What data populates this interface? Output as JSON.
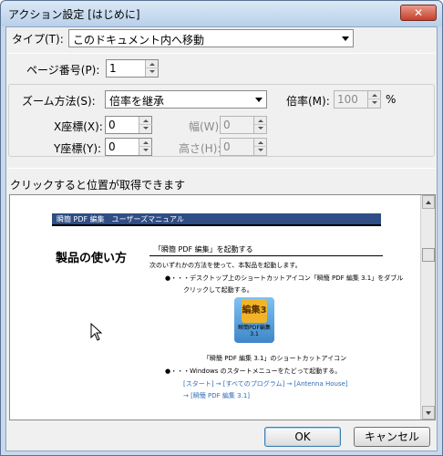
{
  "window": {
    "title": "アクション設定 [はじめに]",
    "close_glyph": "✕"
  },
  "type_row": {
    "label": "タイプ(T):",
    "value": "このドキュメント内へ移動"
  },
  "page_row": {
    "label": "ページ番号(P):",
    "value": "1"
  },
  "zoom_row": {
    "label": "ズーム方法(S):",
    "value": "倍率を継承",
    "rate_label": "倍率(M):",
    "rate_value": "100",
    "rate_unit": "%"
  },
  "coords": {
    "x_label": "X座標(X):",
    "x_value": "0",
    "y_label": "Y座標(Y):",
    "y_value": "0",
    "w_label": "幅(W):",
    "w_value": "0",
    "h_label": "高さ(H):",
    "h_value": "0"
  },
  "preview": {
    "caption": "クリックすると位置が取得できます",
    "doc": {
      "header": "瞬簡 PDF 編集　ユーザーズマニュアル",
      "h1": "製品の使い方",
      "h2": "「瞬簡 PDF 編集」を起動する",
      "lines": [
        "次のいずれかの方法を使って、本製品を起動します。",
        "●・・・デスクトップ上のショートカットアイコン「瞬簡 PDF 編集 3.1」をダブル",
        "クリックして起動する。",
        "「瞬簡 PDF 編集 3.1」のショートカットアイコン",
        "●・・・Windows のスタートメニューをたどって起動する。"
      ],
      "links": [
        "[スタート] → [すべてのプログラム] → [Antenna House]",
        "→ [瞬簡 PDF 編集 3.1]"
      ],
      "icon_glyph": "編集3",
      "icon_caption": "瞬簡PDF編集3.1"
    }
  },
  "buttons": {
    "ok": "OK",
    "cancel": "キャンセル"
  }
}
